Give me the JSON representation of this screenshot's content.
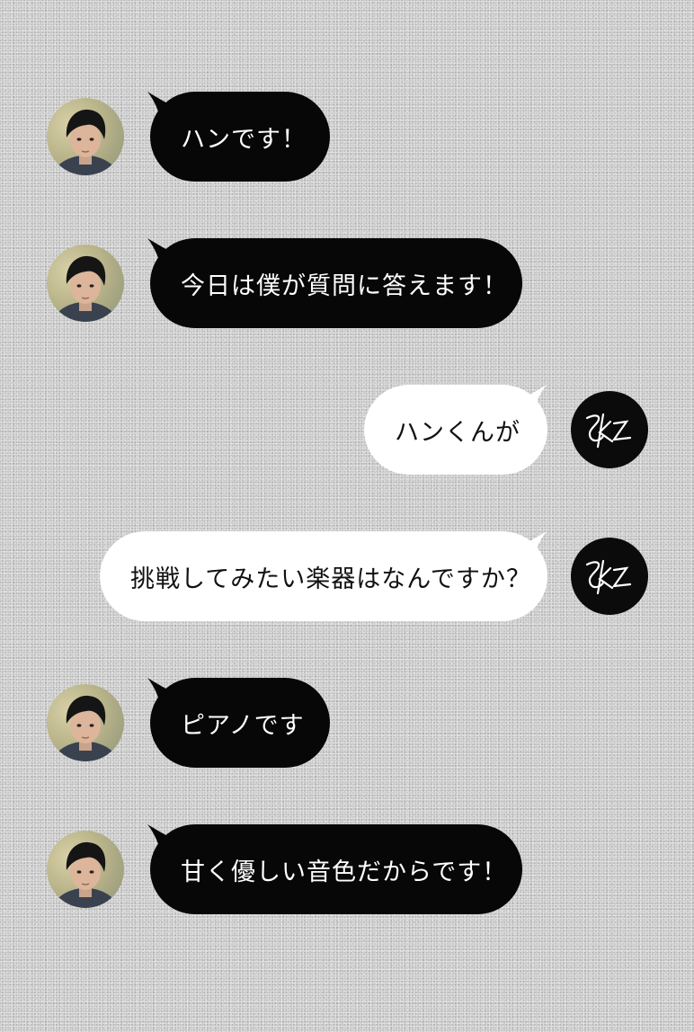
{
  "conversation": {
    "messages": [
      {
        "sender": "han",
        "side": "left",
        "text": "ハンです！"
      },
      {
        "sender": "han",
        "side": "left",
        "text": "今日は僕が質問に答えます！"
      },
      {
        "sender": "skz",
        "side": "right",
        "text": "ハンくんが"
      },
      {
        "sender": "skz",
        "side": "right",
        "text": "挑戦してみたい楽器はなんですか？"
      },
      {
        "sender": "han",
        "side": "left",
        "text": "ピアノです"
      },
      {
        "sender": "han",
        "side": "left",
        "text": "甘く優しい音色だからです！"
      }
    ]
  },
  "logo": {
    "text": "SKZ",
    "icon": "skz-logo-icon"
  },
  "colors": {
    "dark_bubble": "#070707",
    "light_bubble": "#ffffff",
    "background": "#c8c8c8"
  }
}
